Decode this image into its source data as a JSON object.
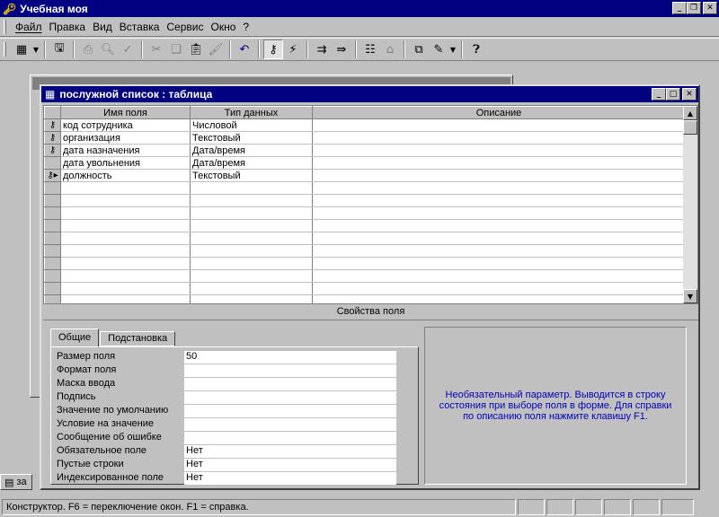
{
  "app": {
    "title": "Учебная моя"
  },
  "menu": [
    {
      "label": "Файл"
    },
    {
      "label": "Правка"
    },
    {
      "label": "Вид"
    },
    {
      "label": "Вставка"
    },
    {
      "label": "Сервис"
    },
    {
      "label": "Окно"
    },
    {
      "label": "?"
    }
  ],
  "toolbar_icons": [
    "view-icon",
    "save-icon",
    "print-icon",
    "preview-icon",
    "spell-icon",
    "cut-icon",
    "copy-icon",
    "paste-icon",
    "format-painter-icon",
    "undo-icon",
    "primary-key-icon",
    "indexes-icon",
    "insert-row-icon",
    "delete-row-icon",
    "properties-icon",
    "build-icon",
    "database-window-icon",
    "new-object-icon",
    "help-icon"
  ],
  "child": {
    "title": "послужной список : таблица"
  },
  "grid": {
    "headers": [
      "Имя поля",
      "Тип данных",
      "Описание"
    ],
    "rows": [
      {
        "key": true,
        "current": false,
        "name": "код сотрудника",
        "type": "Числовой",
        "desc": ""
      },
      {
        "key": true,
        "current": false,
        "name": "организация",
        "type": "Текстовый",
        "desc": ""
      },
      {
        "key": true,
        "current": false,
        "name": "дата назначения",
        "type": "Дата/время",
        "desc": ""
      },
      {
        "key": false,
        "current": false,
        "name": "дата увольнения",
        "type": "Дата/время",
        "desc": ""
      },
      {
        "key": true,
        "current": true,
        "name": "должность",
        "type": "Текстовый",
        "desc": ""
      }
    ],
    "empty_rows": 10
  },
  "props": {
    "section_label": "Свойства поля",
    "tabs": [
      {
        "label": "Общие"
      },
      {
        "label": "Подстановка"
      }
    ],
    "rows": [
      {
        "label": "Размер поля",
        "value": "50"
      },
      {
        "label": "Формат поля",
        "value": ""
      },
      {
        "label": "Маска ввода",
        "value": ""
      },
      {
        "label": "Подпись",
        "value": ""
      },
      {
        "label": "Значение по умолчанию",
        "value": ""
      },
      {
        "label": "Условие на значение",
        "value": ""
      },
      {
        "label": "Сообщение об ошибке",
        "value": ""
      },
      {
        "label": "Обязательное поле",
        "value": "Нет"
      },
      {
        "label": "Пустые строки",
        "value": "Нет"
      },
      {
        "label": "Индексированное поле",
        "value": "Нет"
      }
    ],
    "help_text": "Необязательный параметр.  Выводится в строку состояния при выборе поля в форме.  Для справки по описанию поля нажмите клавишу F1."
  },
  "minimized": {
    "label": "за"
  },
  "status": {
    "text": "Конструктор.  F6 = переключение окон.  F1 = справка."
  },
  "colors": {
    "titlebar": "#000080",
    "face": "#c0c0c0",
    "help_text": "#0000c0"
  }
}
